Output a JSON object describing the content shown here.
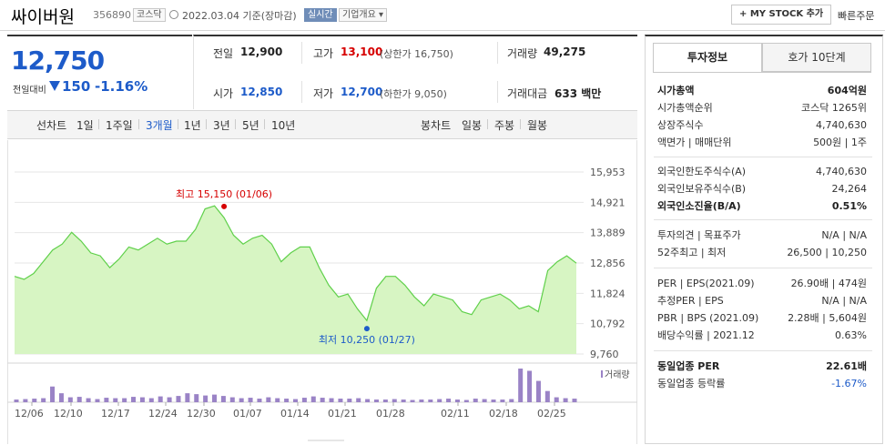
{
  "header": {
    "name": "싸이버원",
    "code": "356890",
    "market": "코스닥",
    "date": "2022.03.04  기준(장마감)",
    "realtime": "실시간",
    "company_overview": "기업개요",
    "mystock": "+ MY STOCK 추가",
    "quick_order": "빠른주문"
  },
  "price": {
    "current": "12,750",
    "change_label": "전일대비",
    "change_amount": "150",
    "change_pct": "-1.16%"
  },
  "stats": {
    "prev_label": "전일",
    "prev": "12,900",
    "high_label": "고가",
    "high": "13,100",
    "upper_limit": "(상한가 16,750)",
    "volume_label": "거래량",
    "volume": "49,275",
    "open_label": "시가",
    "open": "12,850",
    "low_label": "저가",
    "low": "12,700",
    "lower_limit": "(하한가 9,050)",
    "amount_label": "거래대금",
    "amount": "633 백만"
  },
  "period": {
    "line_label": "선차트",
    "line_items": [
      "1일",
      "1주일",
      "3개월",
      "1년",
      "3년",
      "5년",
      "10년"
    ],
    "candle_label": "봉차트",
    "candle_items": [
      "일봉",
      "주봉",
      "월봉"
    ]
  },
  "colors": {
    "price_blue": "#1d5bc9",
    "up_red": "#d60000",
    "area_fill": "#d7f5c3",
    "area_line": "#5fd04a",
    "volume_bar": "#9a83c6"
  },
  "chart_data": {
    "type": "area",
    "x": [
      "12/06",
      "12/07",
      "12/08",
      "12/09",
      "12/10",
      "12/13",
      "12/14",
      "12/15",
      "12/16",
      "12/17",
      "12/20",
      "12/21",
      "12/22",
      "12/23",
      "12/24",
      "12/27",
      "12/28",
      "12/29",
      "12/30",
      "01/03",
      "01/04",
      "01/05",
      "01/06",
      "01/07",
      "01/10",
      "01/11",
      "01/12",
      "01/13",
      "01/14",
      "01/17",
      "01/18",
      "01/19",
      "01/20",
      "01/21",
      "01/24",
      "01/25",
      "01/26",
      "01/27",
      "01/28",
      "02/03",
      "02/04",
      "02/07",
      "02/08",
      "02/09",
      "02/10",
      "02/11",
      "02/14",
      "02/15",
      "02/16",
      "02/17",
      "02/18",
      "02/21",
      "02/22",
      "02/23",
      "02/24",
      "02/25",
      "02/28",
      "03/02",
      "03/03",
      "03/04"
    ],
    "series": [
      {
        "values": [
          12400,
          12300,
          12500,
          12900,
          13300,
          13500,
          13900,
          13600,
          13200,
          13100,
          12700,
          13000,
          13400,
          13300,
          13500,
          13700,
          13500,
          13600,
          13600,
          14000,
          14700,
          14800,
          14400,
          13800,
          13500,
          13700,
          13800,
          13500,
          12900,
          13200,
          13400,
          13400,
          12700,
          12100,
          11700,
          11800,
          11300,
          10900,
          12000,
          12400,
          12400,
          12100,
          11700,
          11400,
          11800,
          11700,
          11600,
          11200,
          11100,
          11600,
          11700,
          11800,
          11600,
          11300,
          11400,
          11200,
          12600,
          12900,
          13100,
          12850
        ]
      }
    ],
    "annotations": [
      {
        "label": "최고 15,150 (01/06)",
        "x": "01/06",
        "value": 15150
      },
      {
        "label": "최저 10,250 (01/27)",
        "x": "01/27",
        "value": 10250
      }
    ],
    "y_ticks": [
      "15,953",
      "14,921",
      "13,889",
      "12,856",
      "11,824",
      "10,792",
      "9,760"
    ],
    "ylim": [
      9760,
      15953
    ],
    "x_ticks": [
      "12/06",
      "12/10",
      "12/17",
      "12/24",
      "12/30",
      "01/07",
      "01/14",
      "01/21",
      "01/28",
      "02/11",
      "02/18",
      "02/25"
    ],
    "volume_label": "거래량",
    "volume": [
      12,
      14,
      16,
      18,
      70,
      40,
      22,
      24,
      18,
      14,
      20,
      18,
      18,
      24,
      22,
      18,
      26,
      22,
      28,
      40,
      36,
      30,
      34,
      28,
      22,
      18,
      20,
      16,
      22,
      18,
      16,
      14,
      20,
      26,
      20,
      18,
      16,
      16,
      18,
      14,
      12,
      12,
      14,
      12,
      10,
      12,
      12,
      14,
      16,
      12,
      10,
      16,
      14,
      12,
      12,
      14,
      150,
      140,
      95,
      50,
      22,
      18,
      16
    ],
    "grid": true,
    "legend": "none"
  },
  "side": {
    "tab_invest": "투자정보",
    "tab_orderbook": "호가 10단계",
    "rows1": [
      {
        "l": "시가총액",
        "r": "604억원",
        "bold": true
      },
      {
        "l": "시가총액순위",
        "r": "코스닥 1265위"
      },
      {
        "l": "상장주식수",
        "r": "4,740,630"
      },
      {
        "l": "액면가 | 매매단위",
        "r": "500원 | 1주"
      }
    ],
    "rows2": [
      {
        "l": "외국인한도주식수(A)",
        "r": "4,740,630"
      },
      {
        "l": "외국인보유주식수(B)",
        "r": "24,264"
      },
      {
        "l": "외국인소진율(B/A)",
        "r": "0.51%",
        "bold": true
      }
    ],
    "rows3": [
      {
        "l": "투자의견 | 목표주가",
        "r": "N/A | N/A"
      },
      {
        "l": "52주최고 | 최저",
        "r": "26,500 | 10,250"
      }
    ],
    "rows4": [
      {
        "l": "PER | EPS(2021.09)",
        "r": "26.90배 | 474원"
      },
      {
        "l": "추정PER | EPS",
        "r": "N/A | N/A"
      },
      {
        "l": "PBR | BPS (2021.09)",
        "r": "2.28배 | 5,604원"
      },
      {
        "l": "배당수익률 | 2021.12",
        "r": "0.63%"
      }
    ],
    "rows5": [
      {
        "l": "동일업종 PER",
        "r": "22.61배",
        "bold": true
      },
      {
        "l": "동일업종 등락률",
        "r": "-1.67%",
        "blue": true
      }
    ]
  }
}
